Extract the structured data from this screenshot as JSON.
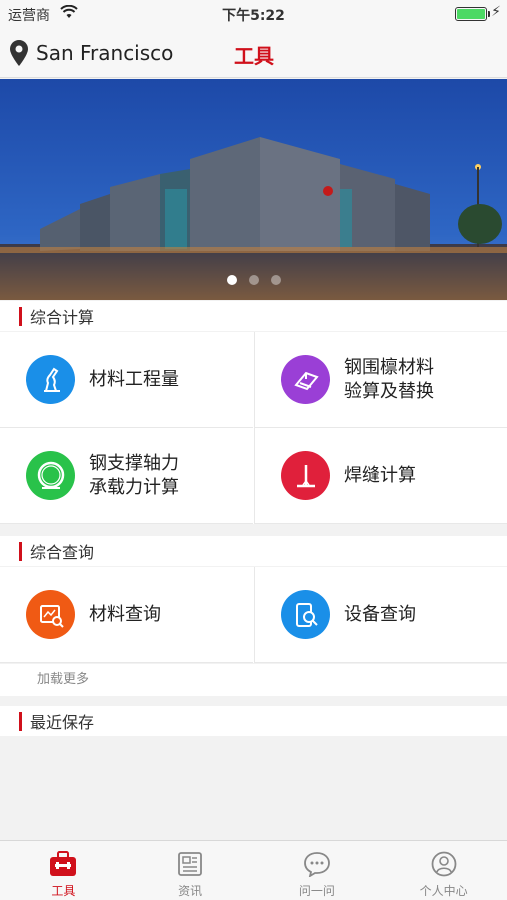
{
  "status_bar": {
    "carrier": "运营商",
    "time": "下午5:22"
  },
  "nav": {
    "location": "San Francisco",
    "title": "工具"
  },
  "banner": {
    "page_count": 3,
    "active_index": 0
  },
  "sections": {
    "calc": {
      "title": "综合计算",
      "items": [
        {
          "label": "材料工程量",
          "icon": "measure-tool-icon",
          "color": "#1a8fe8"
        },
        {
          "label": "钢围檩材料\n验算及替换",
          "icon": "steel-beam-icon",
          "color": "#9a3fd6"
        },
        {
          "label": "钢支撑轴力\n承载力计算",
          "icon": "steel-ring-icon",
          "color": "#29c24a"
        },
        {
          "label": "焊缝计算",
          "icon": "weld-icon",
          "color": "#e0203b"
        }
      ]
    },
    "query": {
      "title": "综合查询",
      "items": [
        {
          "label": "材料查询",
          "icon": "material-search-icon",
          "color": "#f05a14"
        },
        {
          "label": "设备查询",
          "icon": "device-search-icon",
          "color": "#1a8fe8"
        }
      ],
      "load_more": "加载更多"
    },
    "recent": {
      "title": "最近保存"
    }
  },
  "tabs": [
    {
      "label": "工具",
      "icon": "toolbox-icon",
      "active": true
    },
    {
      "label": "资讯",
      "icon": "news-icon",
      "active": false
    },
    {
      "label": "问一问",
      "icon": "chat-icon",
      "active": false
    },
    {
      "label": "个人中心",
      "icon": "user-icon",
      "active": false
    }
  ]
}
